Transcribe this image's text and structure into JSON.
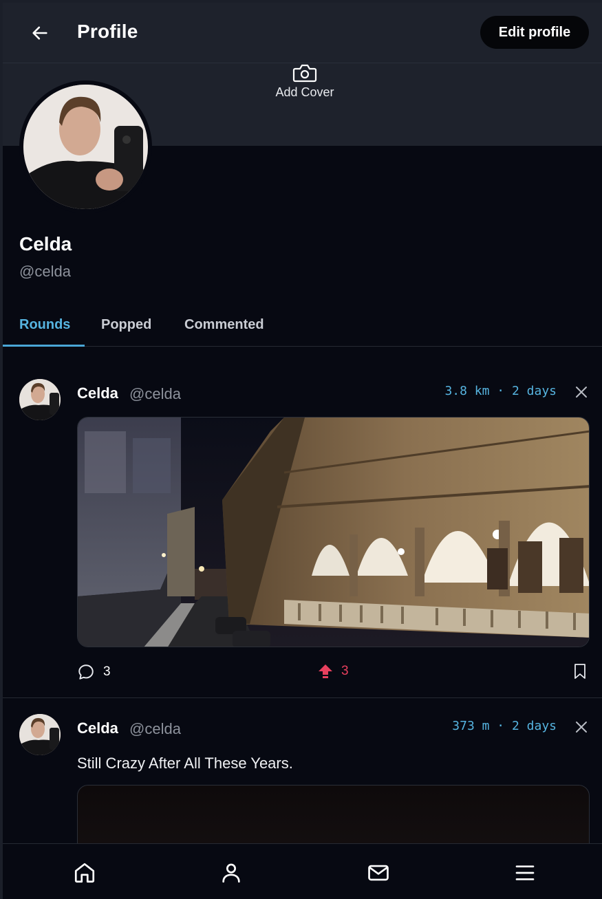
{
  "header": {
    "title": "Profile",
    "edit_label": "Edit profile"
  },
  "cover": {
    "add_label": "Add Cover"
  },
  "profile": {
    "display_name": "Celda",
    "handle": "@celda"
  },
  "tabs": [
    {
      "label": "Rounds",
      "active": true
    },
    {
      "label": "Popped",
      "active": false
    },
    {
      "label": "Commented",
      "active": false
    }
  ],
  "posts": [
    {
      "author": "Celda",
      "handle": "@celda",
      "meta": "3.8 km · 2 days",
      "text": "",
      "comments": "3",
      "pops": "3"
    },
    {
      "author": "Celda",
      "handle": "@celda",
      "meta": "373 m · 2 days",
      "text": "Still Crazy After All These Years."
    }
  ],
  "colors": {
    "accent": "#56b4e0",
    "pop": "#e8405e",
    "background": "#070912",
    "header": "#1e222c"
  },
  "icons": {
    "back": "arrow-left-icon",
    "camera": "camera-icon",
    "comment": "comment-bubble-icon",
    "pop": "pop-arrow-icon",
    "bookmark": "bookmark-icon",
    "close": "close-icon",
    "home": "home-icon",
    "profile": "user-icon",
    "messages": "mail-icon",
    "menu": "menu-icon"
  }
}
